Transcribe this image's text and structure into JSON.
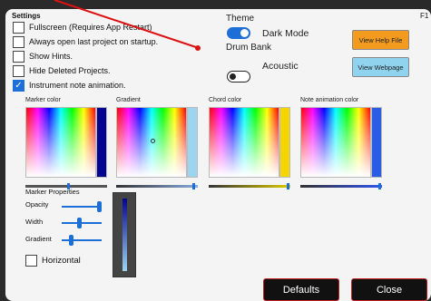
{
  "settings": {
    "title": "Settings",
    "shortcut": "F1",
    "checkboxes": [
      {
        "label": "Fullscreen (Requires App Restart)",
        "checked": false
      },
      {
        "label": "Always open last project on startup.",
        "checked": false
      },
      {
        "label": "Show Hints.",
        "checked": false
      },
      {
        "label": "Hide Deleted Projects.",
        "checked": false
      },
      {
        "label": "Instrument note animation.",
        "checked": true
      }
    ],
    "theme": {
      "label": "Theme",
      "toggle_label": "Dark Mode",
      "on": true
    },
    "drum_bank": {
      "label": "Drum Bank",
      "toggle_label": "Acoustic",
      "on": false
    },
    "help_button": "View Help File",
    "web_button": "View Webpage",
    "colors": [
      {
        "label": "Marker color",
        "bar_color": "#05058f"
      },
      {
        "label": "Gradient",
        "bar_color": "#9dd4ee"
      },
      {
        "label": "Chord color",
        "bar_color": "#f5d500"
      },
      {
        "label": "Note animation color",
        "bar_color": "#2b5ce6"
      }
    ],
    "marker_properties": {
      "title": "Marker Properties",
      "sliders": [
        {
          "label": "Opacity",
          "value": 0.9
        },
        {
          "label": "Width",
          "value": 0.4
        },
        {
          "label": "Gradient",
          "value": 0.2
        }
      ],
      "horizontal_label": "Horizontal",
      "horizontal_checked": false
    },
    "defaults_button": "Defaults",
    "close_button": "Close"
  }
}
